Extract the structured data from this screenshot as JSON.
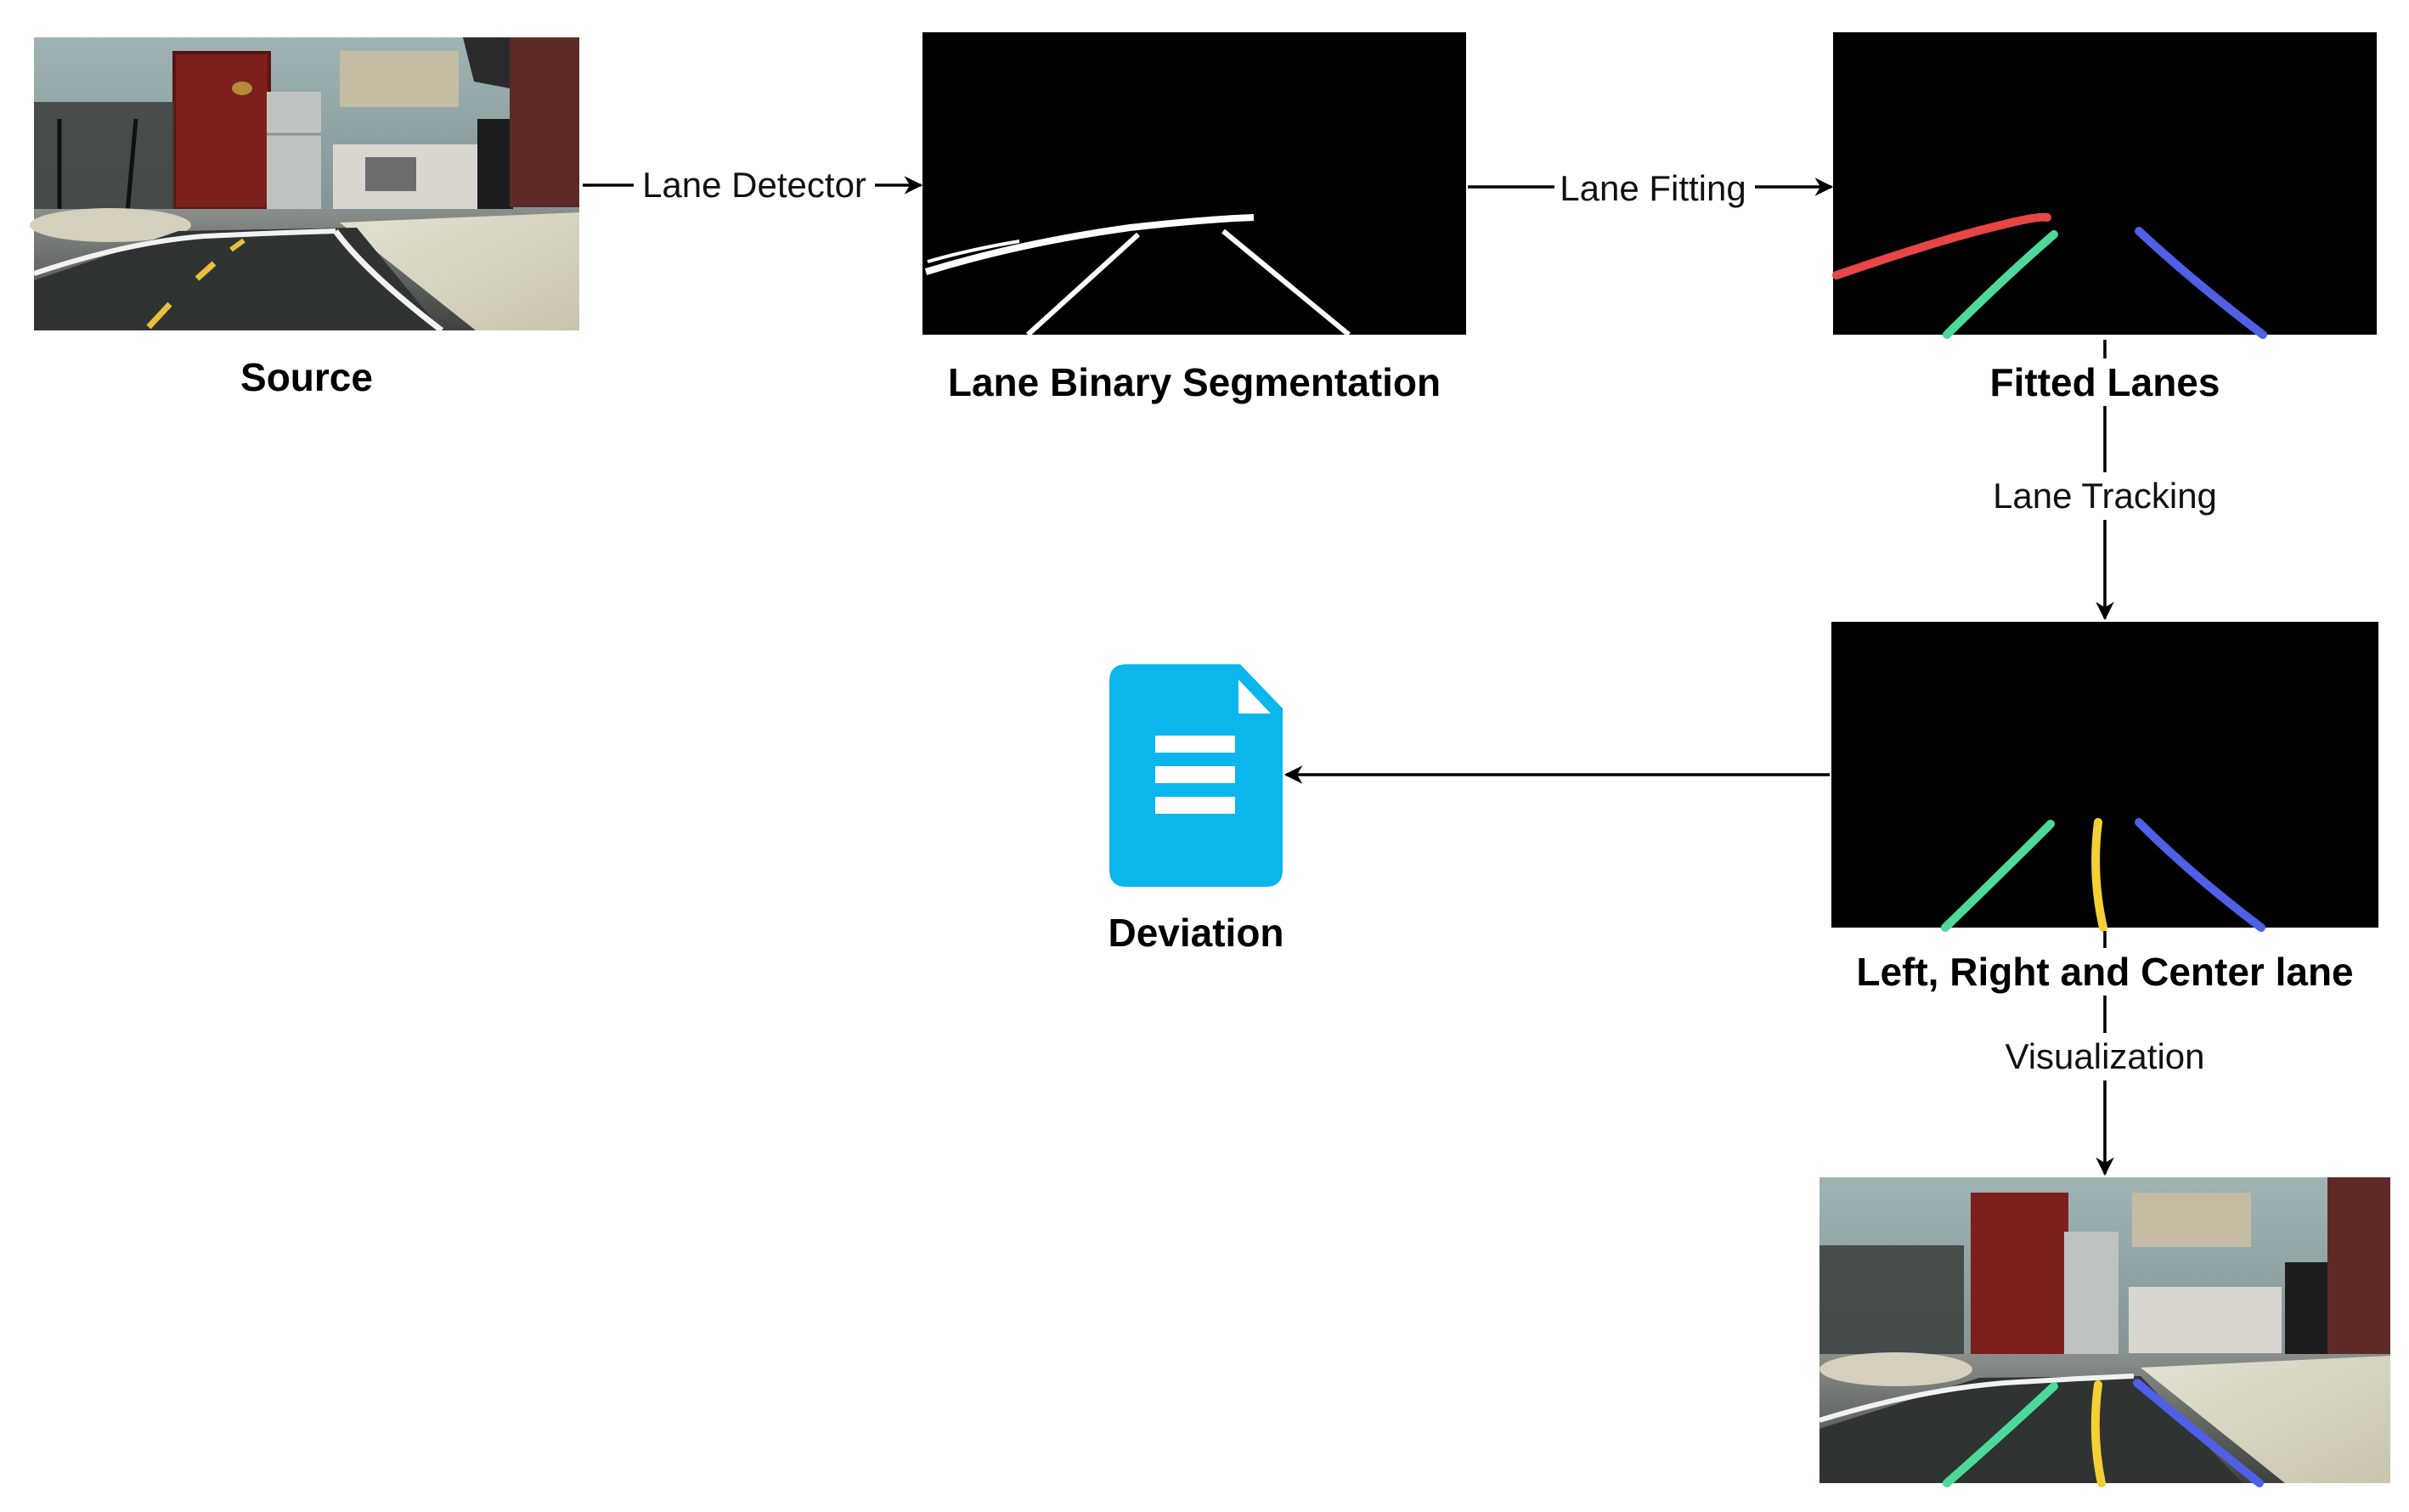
{
  "nodes": {
    "source": {
      "label": "Source"
    },
    "binary": {
      "label": "Lane Binary Segmentation"
    },
    "fitted": {
      "label": "Fitted Lanes"
    },
    "tracked": {
      "label": "Left, Right and Center lane"
    },
    "deviation": {
      "label": "Deviation",
      "icon": "document-icon"
    },
    "visualized": {
      "label": ""
    }
  },
  "edges": {
    "lane_detector": "Lane Detector",
    "lane_fitting": "Lane Fitting",
    "lane_tracking": "Lane Tracking",
    "visualization": "Visualization"
  },
  "colors": {
    "left_lane": "#4ed99a",
    "right_lane": "#4f5fe6",
    "center_lane": "#f5d033",
    "horizon_lane": "#e84545",
    "document_icon": "#0bb6ec",
    "panel_bg": "#000000"
  }
}
